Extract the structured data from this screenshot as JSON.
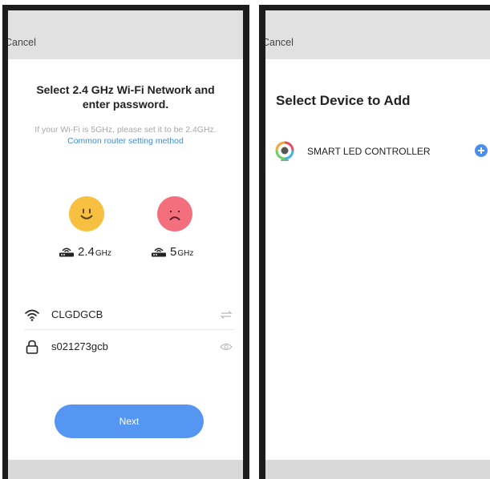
{
  "left_screen": {
    "nav": {
      "cancel_label": "Cancel"
    },
    "title_line1": "Select 2.4 GHz Wi-Fi Network and",
    "title_line2": "enter password.",
    "hint": "If your Wi-Fi is 5GHz, please set it to be 2.4GHz.",
    "link": "Common router setting method",
    "bands": [
      {
        "value": "2.4",
        "unit": "GHz",
        "face": "happy-face-icon",
        "color": "#f7c040"
      },
      {
        "value": "5",
        "unit": "GHz",
        "face": "sad-face-icon",
        "color": "#f36f7d"
      }
    ],
    "wifi": {
      "ssid": "CLGDGCB",
      "icon": "wifi-icon",
      "trailing_icon": "switch-network-icon"
    },
    "password": {
      "value": "s021273gcb",
      "icon": "lock-icon",
      "trailing_icon": "eye-icon"
    },
    "next_label": "Next",
    "accent_color": "#5596f3"
  },
  "right_screen": {
    "nav": {
      "cancel_label": "Cancel"
    },
    "title": "Select Device to Add",
    "devices": [
      {
        "name": "SMART LED CONTROLLER",
        "icon": "led-controller-icon",
        "action_icon": "add-icon"
      }
    ],
    "accent_color": "#4a8ff0"
  }
}
